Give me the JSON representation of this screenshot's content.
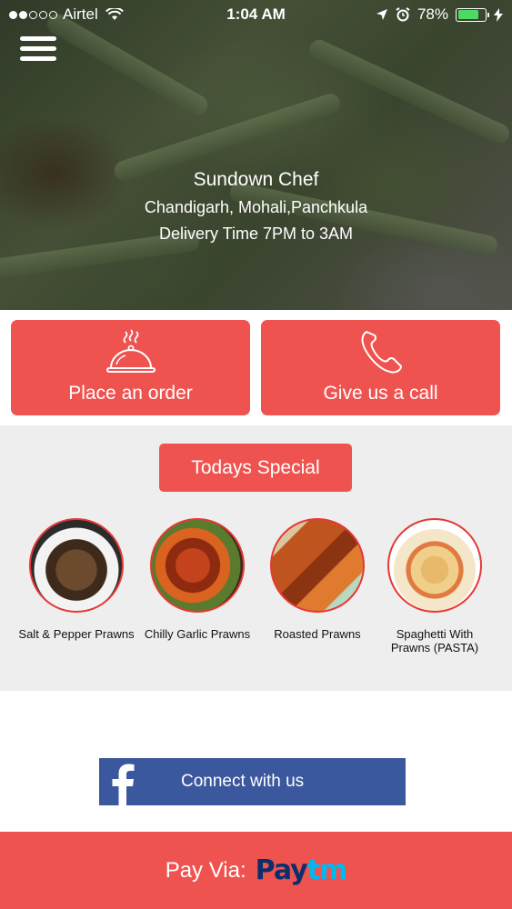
{
  "status_bar": {
    "carrier": "Airtel",
    "time": "1:04 AM",
    "battery_percent": "78%",
    "battery_level": 0.78,
    "signal_full_dots": 2,
    "signal_empty_dots": 3
  },
  "hero": {
    "brand": "Sundown Chef",
    "cities": "Chandigarh, Mohali,Panchkula",
    "delivery": "Delivery Time 7PM to 3AM"
  },
  "actions": {
    "order_label": "Place an order",
    "call_label": "Give us a call"
  },
  "specials": {
    "title": "Todays Special",
    "items": [
      {
        "name": "Salt & Pepper Prawns"
      },
      {
        "name": "Chilly Garlic Prawns"
      },
      {
        "name": "Roasted Prawns"
      },
      {
        "name": "Spaghetti With Prawns (PASTA)"
      }
    ]
  },
  "facebook": {
    "label": "Connect with us"
  },
  "payment": {
    "label": "Pay Via:",
    "logo_part1": "Pay",
    "logo_part2": "tm"
  },
  "colors": {
    "accent": "#ef5350",
    "facebook": "#3b579d",
    "battery": "#4cd964",
    "specials_bg": "#eeeeee"
  }
}
